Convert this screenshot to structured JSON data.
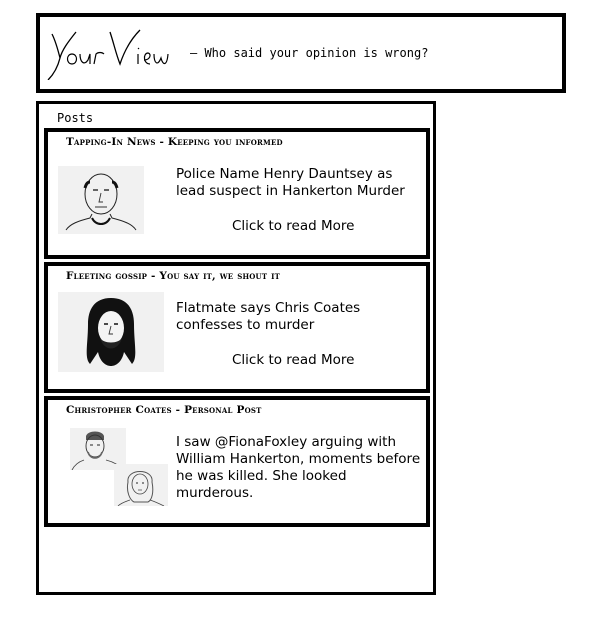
{
  "header": {
    "logo_text": "YourView",
    "tagline": "— Who said your opinion is wrong?"
  },
  "posts_section": {
    "title": "Posts",
    "items": [
      {
        "source": "Tapping-In News - Keeping you informed",
        "headline": "Police Name Henry Dauntsey as lead suspect in Hankerton Murder",
        "read_more": "Click to read More",
        "thumbnail": "bald-man-sketch"
      },
      {
        "source": "Fleeting gossip - You say it, we shout it",
        "headline": "Flatmate says Chris Coates confesses to murder",
        "read_more": "Click to read More",
        "thumbnail": "long-haired-bearded-man-sketch"
      },
      {
        "source": "Christopher Coates - Personal Post",
        "headline": "I saw @FionaFoxley arguing with William Hankerton, moments before he was killed. She looked murderous.",
        "thumbnail": "couple-sketch"
      }
    ]
  }
}
